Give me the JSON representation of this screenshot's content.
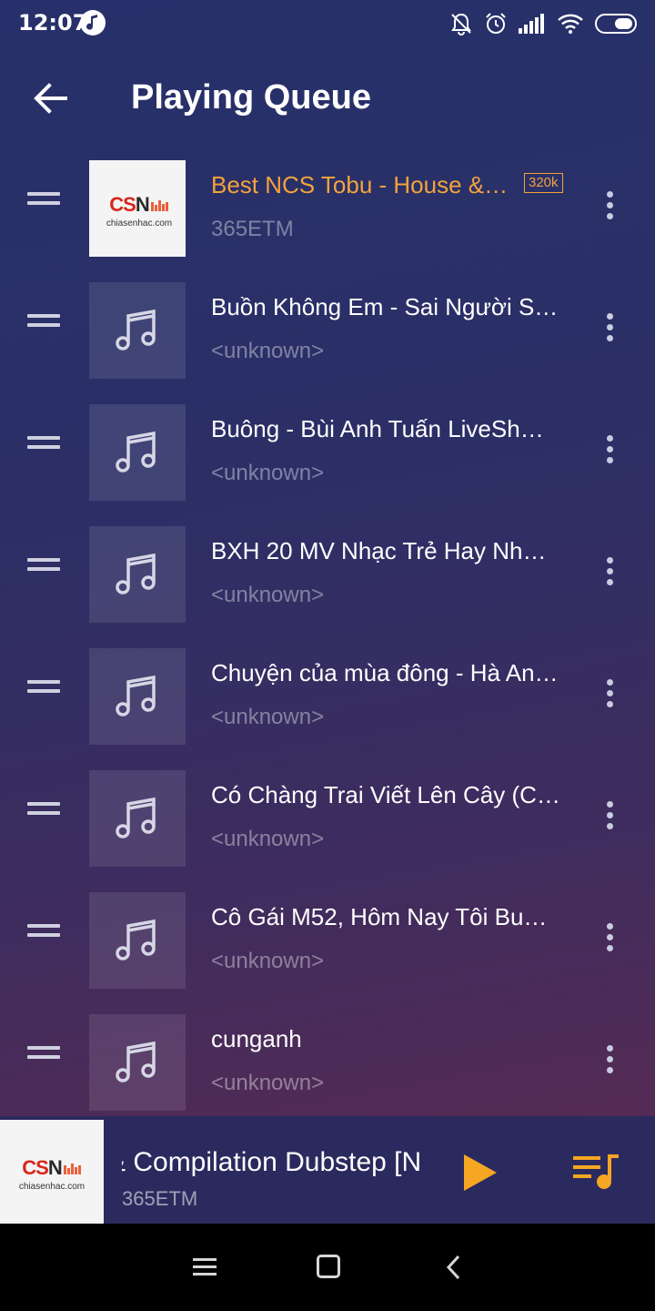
{
  "status_bar": {
    "time": "12:07",
    "icons": [
      "music-note-icon",
      "bell-off-icon",
      "alarm-icon",
      "signal-icon",
      "wifi-icon",
      "battery-icon"
    ]
  },
  "header": {
    "title": "Playing Queue",
    "back_icon": "arrow-left-icon"
  },
  "colors": {
    "accent": "#f2a33c",
    "background_top": "#27306a",
    "background_bottom": "#5c2a50",
    "mini_player_bg": "#2b2a5e"
  },
  "queue": {
    "items": [
      {
        "title": "Best NCS Tobu - House &…",
        "artist": "365ETM",
        "badge": "320k",
        "artwork": "csn-logo",
        "active": true
      },
      {
        "title": "Buồn Không Em - Sai Người S…",
        "artist": "<unknown>",
        "artwork": "music-note-icon"
      },
      {
        "title": "Buông - Bùi Anh Tuấn  LiveSh…",
        "artist": "<unknown>",
        "artwork": "music-note-icon"
      },
      {
        "title": "BXH 20 MV Nhạc Trẻ Hay Nh…",
        "artist": "<unknown>",
        "artwork": "music-note-icon"
      },
      {
        "title": "Chuyện của mùa đông - Hà An…",
        "artist": "<unknown>",
        "artwork": "music-note-icon"
      },
      {
        "title": "Có Chàng Trai Viết Lên Cây (C…",
        "artist": "<unknown>",
        "artwork": "music-note-icon"
      },
      {
        "title": "Cô Gái M52, Hôm Nay Tôi Bu…",
        "artist": "<unknown>",
        "artwork": "music-note-icon"
      },
      {
        "title": "cunganh",
        "artist": "<unknown>",
        "artwork": "music-note-icon"
      }
    ]
  },
  "csn_logo": {
    "mark_red": "CS",
    "mark_dark": "N",
    "domain": "chiasenhac.com"
  },
  "mini_player": {
    "title": "& Compilation Dubstep [N",
    "artist": "365ETM",
    "play_icon": "play-icon",
    "queue_icon": "queue-music-icon"
  },
  "nav_bar": {
    "icons": [
      "menu-icon",
      "home-icon",
      "back-icon"
    ]
  }
}
